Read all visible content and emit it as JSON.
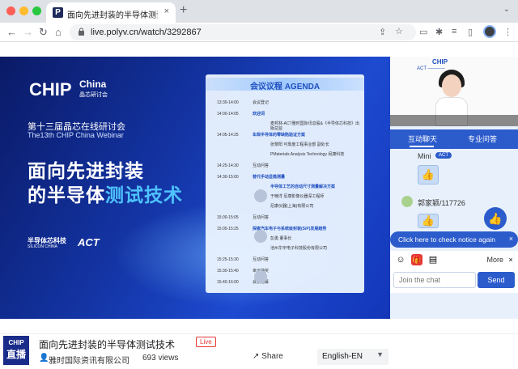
{
  "browser": {
    "tab_title": "面向先进封装的半导体测试技",
    "tab_close": "×",
    "new_tab": "+",
    "url": "live.polyv.cn/watch/3292867",
    "favicon_letter": "P",
    "colors": {
      "close": "#ff5f57",
      "min": "#febc2e",
      "max": "#28c840"
    }
  },
  "toolbar": {
    "back_icon": "←",
    "forward_icon": "→",
    "reload_icon": "↻",
    "home_icon": "⌂",
    "lock_icon": "🔒"
  },
  "slide": {
    "logo_main": "CHIP",
    "logo_china": "China",
    "logo_cn": "晶芯研讨会",
    "event_cn": "第十三届晶芯在线研讨会",
    "event_en": "The13th CHIP China Webinar",
    "title_line1": "面向先进封装",
    "title_line2_a": "的半导体",
    "title_line2_b": "测试技术",
    "org_cn": "半导体芯科技",
    "org_en": "SILICON CHINA",
    "act_logo": "ACT",
    "agenda_title": "会议议程  AGENDA",
    "agenda": [
      {
        "time": "13:30-14:00",
        "text": "会议登记"
      },
      {
        "time": "14:00-14:05",
        "text": "欢迎词"
      },
      {
        "time": "",
        "text": "麦邦林-ACT雅时国际讯息股&《半导体芯科技》出版总监"
      },
      {
        "time": "14:05-14:25",
        "text": "车规半导体的零缺陷验证方案"
      },
      {
        "time": "",
        "text": "张黎阳  可靠度工程事业部 副处长"
      },
      {
        "time": "",
        "text": "PMaterials Analysis Technology 闳康科技"
      },
      {
        "time": "14:25-14:30",
        "text": "互动问答"
      },
      {
        "time": "14:30-15:00",
        "text": "替代手动显微测量"
      },
      {
        "time": "",
        "text": "半导体工艺的自动尺寸测量解决方案"
      },
      {
        "time": "",
        "text": "于楠洋  尼康影像仪器深工程师"
      },
      {
        "time": "",
        "text": "尼康仪器(上海)有限公司"
      },
      {
        "time": "15:00-15:05",
        "text": "互动问答"
      },
      {
        "time": "15:05-15:25",
        "text": "探索汽车电子与系统级封装(SiP)发展趋势"
      },
      {
        "time": "",
        "text": "彭勇  董事长"
      },
      {
        "time": "",
        "text": "池州华宇电子科技股份有限公司"
      },
      {
        "time": "15:25-15:30",
        "text": "互动问答"
      },
      {
        "time": "15:30-15:40",
        "text": "幸运抽奖"
      },
      {
        "time": "15:40-16:00",
        "text": "会议落幕"
      }
    ]
  },
  "chat": {
    "cam_logo": "CHIP",
    "tab_chat": "互动聊天",
    "tab_qa": "专业问答",
    "msg1_name": "Mini",
    "msg1_badge": "ACT",
    "msg2_name": "郭家颖/117726",
    "thumb_icon": "👍",
    "notice": "Click here to check notice again",
    "notice_close": "×",
    "more": "More",
    "input_placeholder": "Join the chat",
    "send": "Send",
    "emoji_icon": "☺",
    "gift_icon": "🎁",
    "doc_icon": "▤"
  },
  "footer": {
    "logo_top": "CHIP",
    "logo_bottom": "直播",
    "video_title": "面向先进封装的半导体测试技术",
    "live": "Live",
    "user_icon": "👤",
    "author": "雅时国际资讯有限公司",
    "views": "693 views",
    "share_icon": "↗",
    "share": "Share",
    "lang": "English-EN",
    "lang_chevron": "▼"
  }
}
